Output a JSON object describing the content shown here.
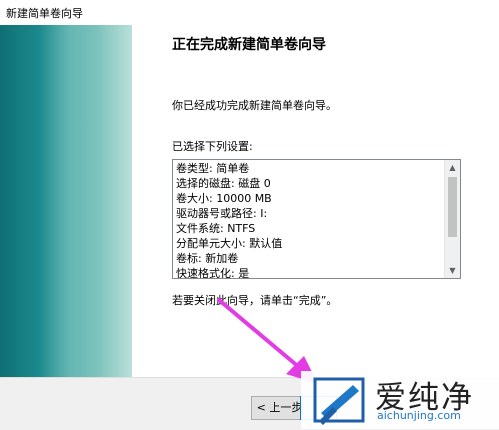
{
  "window": {
    "title": "新建简单卷向导"
  },
  "wizard": {
    "heading": "正在完成新建简单卷向导",
    "intro": "你已经成功完成新建简单卷向导。",
    "list_label": "已选择下列设置:",
    "settings": [
      "卷类型: 简单卷",
      "选择的磁盘: 磁盘 0",
      "卷大小: 10000 MB",
      "驱动器号或路径: I:",
      "文件系统: NTFS",
      "分配单元大小: 默认值",
      "卷标: 新加卷",
      "快速格式化: 是"
    ],
    "closing": "若要关闭此向导，请单击“完成”。"
  },
  "buttons": {
    "back": "< 上一步"
  },
  "watermark": {
    "brand": "爱纯净",
    "url": "aichunjing.com"
  },
  "colors": {
    "arrow": "#e43ce4",
    "sidebar": "#1d8a8d",
    "watermark_url": "#1e78c8"
  },
  "icons": {
    "scroll_up": "▲",
    "scroll_down": "▼"
  }
}
